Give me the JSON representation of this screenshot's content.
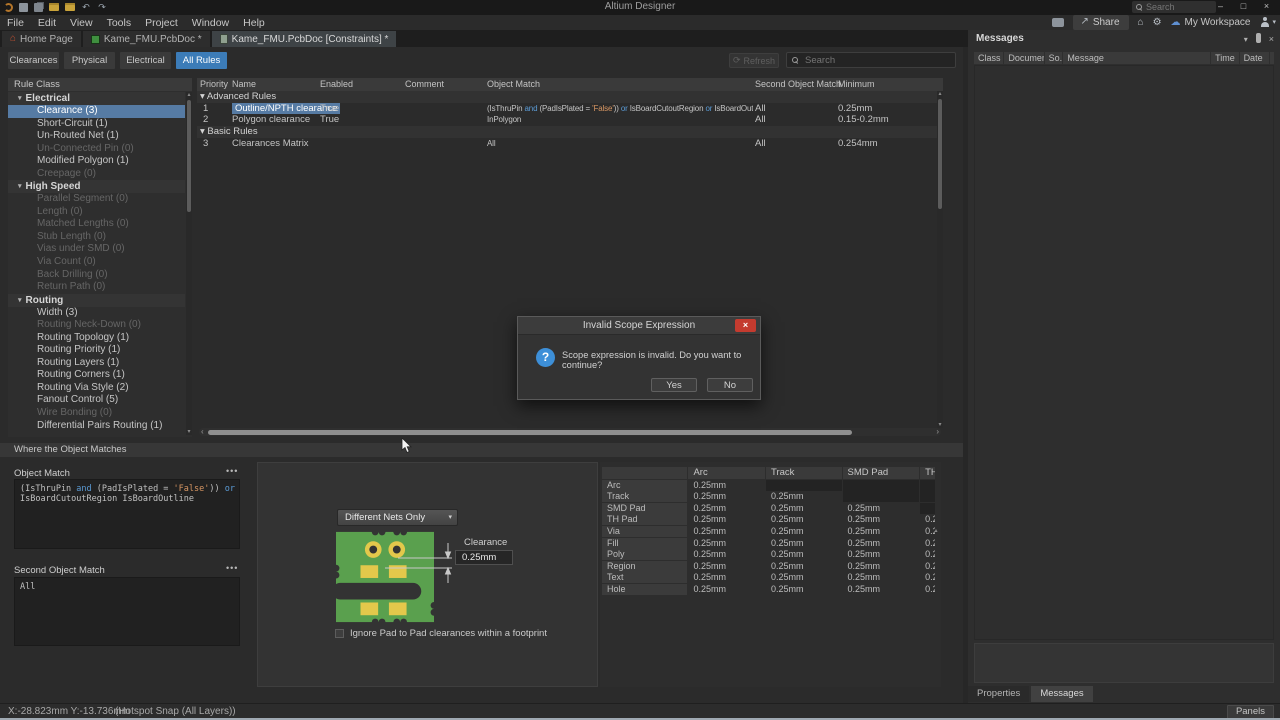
{
  "colors": {
    "selection": "#567BA4",
    "accent": "#3C7CB8",
    "danger": "#C43B2F",
    "info": "#3D8FD8",
    "board": "#5AA04E",
    "pad": "#E3C84B",
    "cutout": "#333333"
  },
  "icons": {
    "search": "magnifier",
    "home": "house",
    "settings": "gear",
    "cloud": "cloud",
    "user": "person",
    "share": "up-right-arrow",
    "close": "x",
    "minimize": "dash",
    "maximize": "square",
    "pin": "pin",
    "dropdown": "triangle-down",
    "refresh": "circular-arrows",
    "undo": "curved-arrow-left",
    "redo": "curved-arrow-right",
    "comment": "speech-bubble",
    "question": "question-mark"
  },
  "titlebar": {
    "app_title": "Altium Designer",
    "search_placeholder": "Search"
  },
  "menubar": {
    "items": [
      "File",
      "Edit",
      "View",
      "Tools",
      "Project",
      "Window",
      "Help"
    ],
    "share_label": "Share",
    "workspace_label": "My Workspace"
  },
  "doc_tabs": [
    {
      "label": "Home Page",
      "icon": "home"
    },
    {
      "label": "Kame_FMU.PcbDoc *",
      "icon": "pcb"
    },
    {
      "label": "Kame_FMU.PcbDoc [Constraints] *",
      "icon": "pcbdoc",
      "active": true
    }
  ],
  "filter_tabs": [
    {
      "label": "Clearances"
    },
    {
      "label": "Physical"
    },
    {
      "label": "Electrical"
    },
    {
      "label": "All Rules",
      "active": true
    }
  ],
  "toolbar": {
    "refresh_label": "Refresh",
    "search_placeholder": "Search"
  },
  "rule_class_panel": {
    "header": "Rule Class",
    "groups": [
      {
        "label": "Electrical",
        "items": [
          {
            "label": "Clearance (3)",
            "selected": true
          },
          {
            "label": "Short-Circuit (1)"
          },
          {
            "label": "Un-Routed Net (1)"
          },
          {
            "label": "Un-Connected Pin (0)",
            "disabled": true
          },
          {
            "label": "Modified Polygon (1)"
          },
          {
            "label": "Creepage (0)",
            "disabled": true
          }
        ]
      },
      {
        "label": "High Speed",
        "items": [
          {
            "label": "Parallel Segment (0)",
            "disabled": true
          },
          {
            "label": "Length (0)",
            "disabled": true
          },
          {
            "label": "Matched Lengths (0)",
            "disabled": true
          },
          {
            "label": "Stub Length (0)",
            "disabled": true
          },
          {
            "label": "Vias under SMD (0)",
            "disabled": true
          },
          {
            "label": "Via Count (0)",
            "disabled": true
          },
          {
            "label": "Back Drilling (0)",
            "disabled": true
          },
          {
            "label": "Return Path (0)",
            "disabled": true
          }
        ]
      },
      {
        "label": "Routing",
        "items": [
          {
            "label": "Width (3)"
          },
          {
            "label": "Routing Neck-Down (0)",
            "disabled": true
          },
          {
            "label": "Routing Topology (1)"
          },
          {
            "label": "Routing Priority (1)"
          },
          {
            "label": "Routing Layers (1)"
          },
          {
            "label": "Routing Corners (1)"
          },
          {
            "label": "Routing Via Style (2)"
          },
          {
            "label": "Fanout Control (5)"
          },
          {
            "label": "Wire Bonding (0)",
            "disabled": true
          },
          {
            "label": "Differential Pairs Routing (1)"
          }
        ]
      }
    ]
  },
  "rules_table": {
    "columns": [
      "Priority",
      "Name",
      "Enabled",
      "Comment",
      "Object Match",
      "Second Object Match",
      "Minimum"
    ],
    "rows": [
      {
        "type": "group",
        "label": "Advanced Rules"
      },
      {
        "type": "rule",
        "priority": "1",
        "name": "Outline/NPTH clearance",
        "selected": true,
        "enabled": "True",
        "comment": "",
        "object_match": [
          {
            "t": "(IsThruPin ",
            "c": "id"
          },
          {
            "t": "and",
            "c": "kw"
          },
          {
            "t": " (PadIsPlated = ",
            "c": "id"
          },
          {
            "t": "'False'",
            "c": "str"
          },
          {
            "t": ")) ",
            "c": "id"
          },
          {
            "t": "or",
            "c": "kw"
          },
          {
            "t": " IsBoardCutoutRegion ",
            "c": "id"
          },
          {
            "t": "or",
            "c": "kw"
          },
          {
            "t": " IsBoardOutline",
            "c": "id"
          }
        ],
        "second": "All",
        "minimum": "0.25mm"
      },
      {
        "type": "rule",
        "priority": "2",
        "name": "Polygon clearance",
        "enabled": "True",
        "comment": "",
        "object_match": [
          {
            "t": "InPolygon",
            "c": "id"
          }
        ],
        "second": "All",
        "minimum": "0.15-0.2mm"
      },
      {
        "type": "group",
        "label": "Basic Rules"
      },
      {
        "type": "rule",
        "priority": "3",
        "name": "Clearances Matrix",
        "enabled": "",
        "comment": "",
        "object_match": [
          {
            "t": "All",
            "c": "id"
          }
        ],
        "second": "All",
        "minimum": "0.254mm"
      }
    ]
  },
  "where_bar_label": "Where the Object Matches",
  "object_match_editor": {
    "label": "Object Match",
    "lines": [
      [
        {
          "t": "(IsThruPin ",
          "c": "id"
        },
        {
          "t": "and",
          "c": "kw"
        },
        {
          "t": " (PadIsPlated = ",
          "c": "id"
        },
        {
          "t": "'False'",
          "c": "str"
        },
        {
          "t": ")) ",
          "c": "id"
        },
        {
          "t": "or",
          "c": "kw"
        }
      ],
      [
        {
          "t": "IsBoardCutoutRegion IsBoardOutline",
          "c": "id"
        }
      ]
    ]
  },
  "second_object_match_editor": {
    "label": "Second Object Match",
    "value": "All"
  },
  "preview": {
    "net_scope": "Different Nets Only",
    "clearance_label": "Clearance",
    "clearance_value": "0.25mm",
    "checkbox_label": "Ignore Pad to Pad clearances within a footprint",
    "checkbox_checked": false
  },
  "matrix": {
    "columns": [
      "",
      "Arc",
      "Track",
      "SMD Pad",
      "TH"
    ],
    "rows": [
      {
        "label": "Arc",
        "values": [
          "0.25mm",
          "",
          "",
          ""
        ]
      },
      {
        "label": "Track",
        "values": [
          "0.25mm",
          "0.25mm",
          "",
          ""
        ]
      },
      {
        "label": "SMD Pad",
        "values": [
          "0.25mm",
          "0.25mm",
          "0.25mm",
          ""
        ]
      },
      {
        "label": "TH Pad",
        "values": [
          "0.25mm",
          "0.25mm",
          "0.25mm",
          "0.2"
        ]
      },
      {
        "label": "Via",
        "values": [
          "0.25mm",
          "0.25mm",
          "0.25mm",
          "0.2"
        ]
      },
      {
        "label": "Fill",
        "values": [
          "0.25mm",
          "0.25mm",
          "0.25mm",
          "0.2"
        ]
      },
      {
        "label": "Poly",
        "values": [
          "0.25mm",
          "0.25mm",
          "0.25mm",
          "0.2"
        ]
      },
      {
        "label": "Region",
        "values": [
          "0.25mm",
          "0.25mm",
          "0.25mm",
          "0.2"
        ]
      },
      {
        "label": "Text",
        "values": [
          "0.25mm",
          "0.25mm",
          "0.25mm",
          "0.2"
        ]
      },
      {
        "label": "Hole",
        "values": [
          "0.25mm",
          "0.25mm",
          "0.25mm",
          "0.2"
        ]
      }
    ]
  },
  "dialog": {
    "title": "Invalid Scope Expression",
    "message": "Scope expression is invalid. Do you want to continue?",
    "yes_label": "Yes",
    "no_label": "No"
  },
  "messages_panel": {
    "title": "Messages",
    "columns": [
      "Class",
      "Document",
      "So...",
      "Message",
      "Time",
      "Date",
      "N..."
    ],
    "tabs": [
      {
        "label": "Properties"
      },
      {
        "label": "Messages",
        "active": true
      }
    ]
  },
  "statusbar": {
    "coordinates": "X:-28.823mm Y:-13.736mm",
    "snap": "(Hotspot Snap (All Layers))",
    "panels_label": "Panels"
  }
}
